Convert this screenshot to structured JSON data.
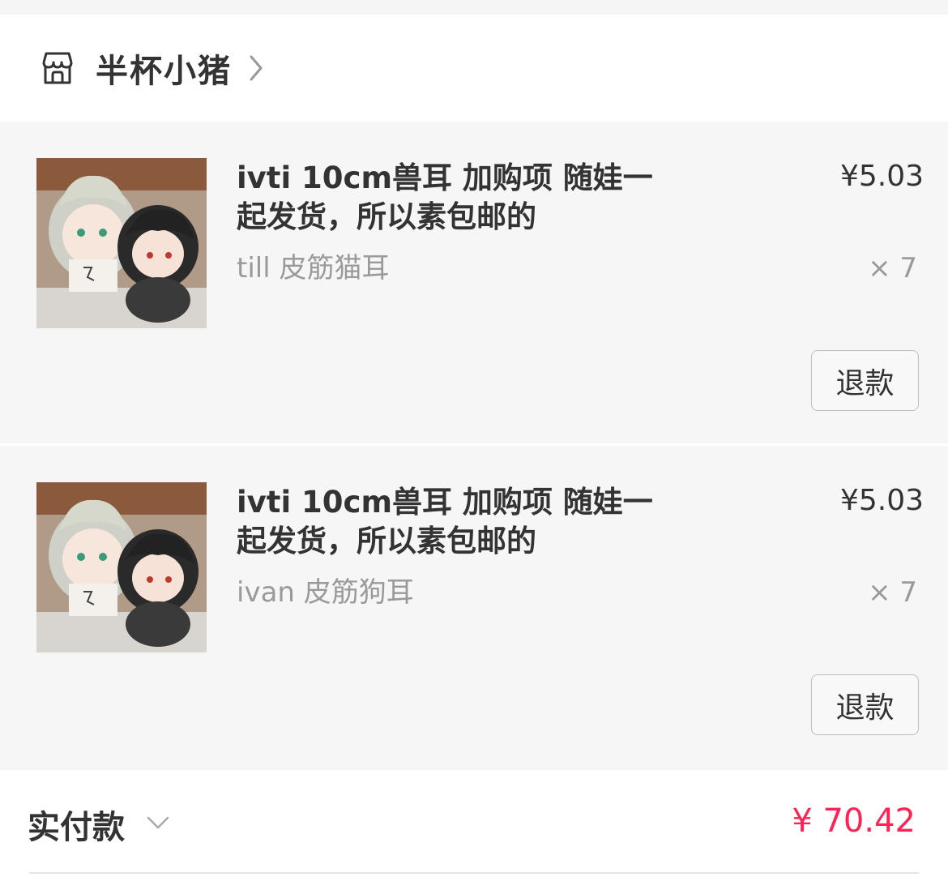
{
  "shop": {
    "name": "半杯小猪",
    "icon": "store-icon",
    "chevron_icon": "chevron-right-icon"
  },
  "items": [
    {
      "title": "ivti 10cm兽耳 加购项  随娃一起发货，所以素包邮的",
      "price": "¥5.03",
      "variant": "till 皮筋猫耳",
      "quantity": "× 7",
      "refund_label": "退款",
      "image": "plush-dolls-photo"
    },
    {
      "title": "ivti 10cm兽耳 加购项  随娃一起发货，所以素包邮的",
      "price": "¥5.03",
      "variant": "ivan 皮筋狗耳",
      "quantity": "× 7",
      "refund_label": "退款",
      "image": "plush-dolls-photo"
    }
  ],
  "summary": {
    "paid_label": "实付款",
    "paid_amount": "¥ 70.42",
    "amount_color": "#ff2255"
  }
}
